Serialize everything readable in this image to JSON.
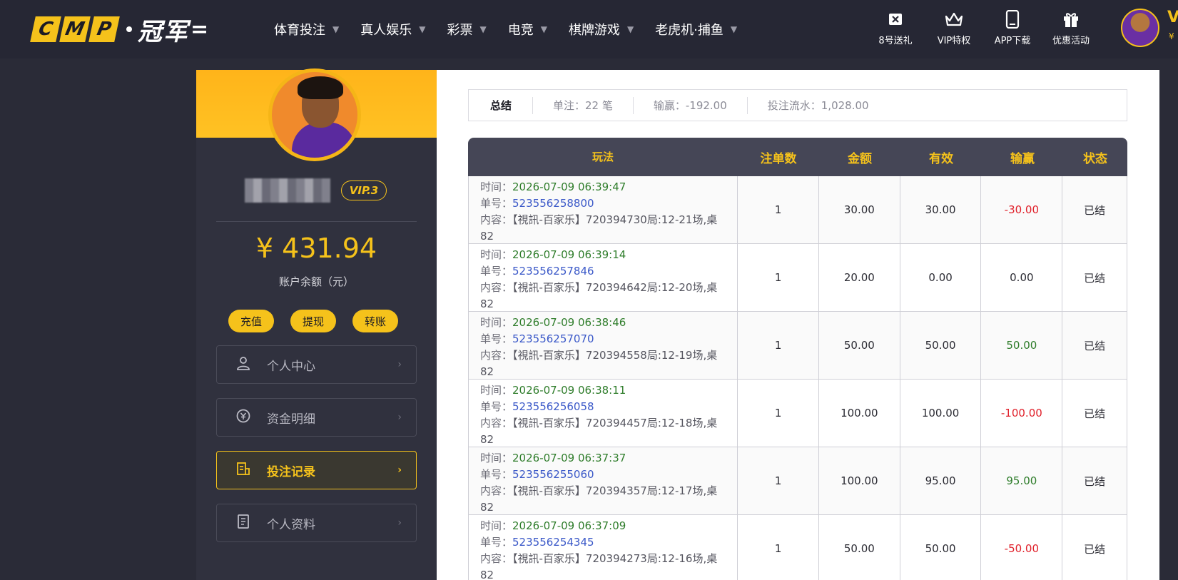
{
  "header": {
    "logo_letters": [
      "C",
      "M",
      "P"
    ],
    "logo_cn": "冠军",
    "nav": [
      {
        "label": "体育投注"
      },
      {
        "label": "真人娱乐"
      },
      {
        "label": "彩票"
      },
      {
        "label": "电竞"
      },
      {
        "label": "棋牌游戏"
      },
      {
        "label": "老虎机·捕鱼"
      }
    ],
    "tools": [
      {
        "label": "8号送礼",
        "icon": "gift-box-icon"
      },
      {
        "label": "VIP特权",
        "icon": "crown-icon"
      },
      {
        "label": "APP下载",
        "icon": "phone-icon"
      },
      {
        "label": "优惠活动",
        "icon": "present-icon"
      }
    ],
    "vip_short": "V",
    "vip_sub": "¥"
  },
  "sidebar": {
    "vip_badge": "VIP.3",
    "balance": "¥ 431.94",
    "balance_label": "账户余额（元）",
    "actions": [
      {
        "label": "充值"
      },
      {
        "label": "提现"
      },
      {
        "label": "转账"
      }
    ],
    "menu": [
      {
        "label": "个人中心",
        "icon": "user-icon",
        "active": false
      },
      {
        "label": "资金明细",
        "icon": "yuan-cycle-icon",
        "active": false
      },
      {
        "label": "投注记录",
        "icon": "bet-record-icon",
        "active": true
      },
      {
        "label": "个人资料",
        "icon": "profile-doc-icon",
        "active": false
      }
    ]
  },
  "summary": {
    "title": "总结",
    "bets": "单注：22 笔",
    "win_loss": "输赢：-192.00",
    "turnover": "投注流水：1,028.00"
  },
  "table": {
    "headers": [
      "玩法",
      "注单数",
      "金额",
      "有效",
      "输赢",
      "状态"
    ],
    "labels": {
      "time": "时间：",
      "order": "单号：",
      "content": "内容："
    },
    "rows": [
      {
        "time": "2026-07-09 06:39:47",
        "order": "523556258800",
        "content": "【視訊-百家乐】720394730局:12-21场,桌82",
        "count": "1",
        "amount": "30.00",
        "valid": "30.00",
        "win": "-30.00",
        "win_sign": "neg",
        "status": "已结"
      },
      {
        "time": "2026-07-09 06:39:14",
        "order": "523556257846",
        "content": "【視訊-百家乐】720394642局:12-20场,桌82",
        "count": "1",
        "amount": "20.00",
        "valid": "0.00",
        "win": "0.00",
        "win_sign": "zero",
        "status": "已结"
      },
      {
        "time": "2026-07-09 06:38:46",
        "order": "523556257070",
        "content": "【視訊-百家乐】720394558局:12-19场,桌82",
        "count": "1",
        "amount": "50.00",
        "valid": "50.00",
        "win": "50.00",
        "win_sign": "pos",
        "status": "已结"
      },
      {
        "time": "2026-07-09 06:38:11",
        "order": "523556256058",
        "content": "【視訊-百家乐】720394457局:12-18场,桌82",
        "count": "1",
        "amount": "100.00",
        "valid": "100.00",
        "win": "-100.00",
        "win_sign": "neg",
        "status": "已结"
      },
      {
        "time": "2026-07-09 06:37:37",
        "order": "523556255060",
        "content": "【視訊-百家乐】720394357局:12-17场,桌82",
        "count": "1",
        "amount": "100.00",
        "valid": "95.00",
        "win": "95.00",
        "win_sign": "pos",
        "status": "已结"
      },
      {
        "time": "2026-07-09 06:37:09",
        "order": "523556254345",
        "content": "【視訊-百家乐】720394273局:12-16场,桌82",
        "count": "1",
        "amount": "50.00",
        "valid": "50.00",
        "win": "-50.00",
        "win_sign": "neg",
        "status": "已结"
      }
    ]
  },
  "colors": {
    "accent": "#f5c21b",
    "negative": "#e0202a",
    "positive": "#2f7d2b",
    "order_link": "#3a58c8"
  }
}
